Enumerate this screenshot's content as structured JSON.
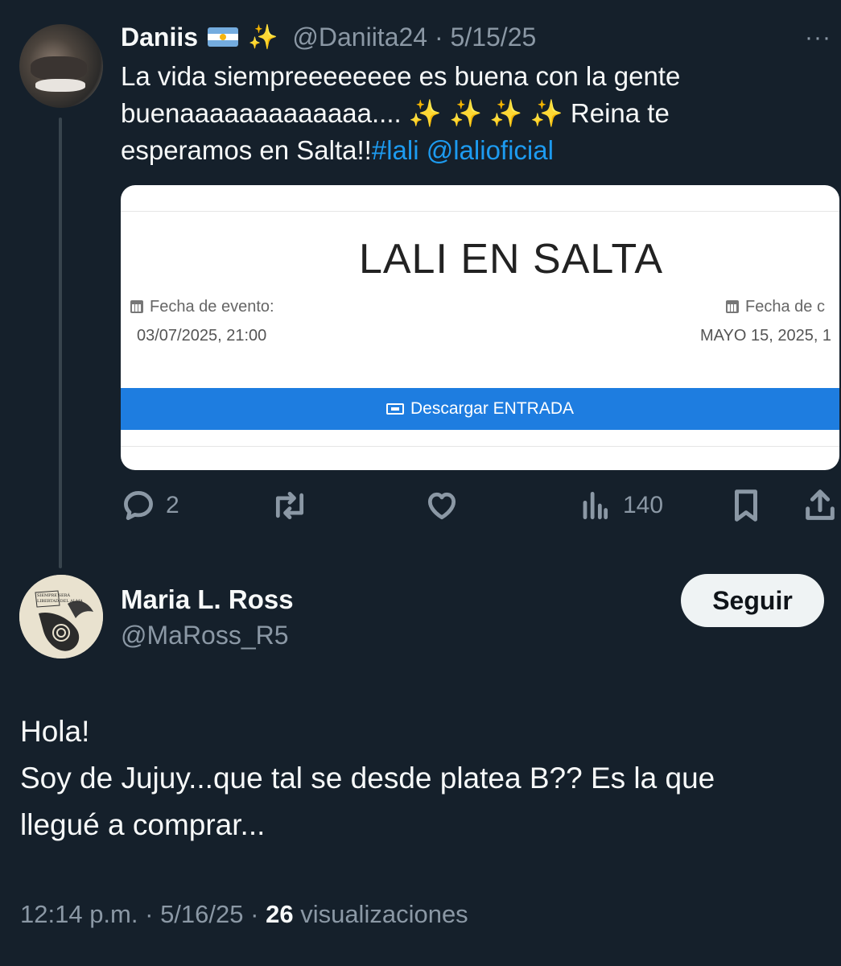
{
  "parent_tweet": {
    "name": "Daniis",
    "emoji_sparkle": "✨",
    "handle": "@Daniita24",
    "date": "5/15/25",
    "more": "···",
    "text_line1": "La vida siempreeeeeeee es buena con la gente",
    "text_line2_a": "buenaaaaaaaaaaaaa....",
    "text_sparkles": "✨ ✨ ✨ ✨",
    "text_line2_b": "Reina te",
    "text_line3": "esperamos en Salta!!",
    "hashtag": "#lali",
    "mention": "@lalioficial",
    "image_card": {
      "title": "LALI EN SALTA",
      "left_label": "Fecha de evento:",
      "left_value": "03/07/2025, 21:00",
      "right_label": "Fecha de c",
      "right_value": "MAYO 15, 2025, 1",
      "button_label": "Descargar ENTRADA"
    },
    "actions": {
      "replies": "2",
      "retweets": "",
      "likes": "",
      "views": "140"
    }
  },
  "reply_tweet": {
    "name": "Maria L. Ross",
    "handle": "@MaRoss_R5",
    "follow_label": "Seguir",
    "text_line1": "Hola!",
    "text_line2": "Soy de Jujuy...que tal se desde platea B?? Es la que",
    "text_line3": "llegué a comprar...",
    "time": "12:14 p.m.",
    "date": "5/16/25",
    "views_count": "26",
    "views_label": "visualizaciones",
    "separator": "·",
    "avatar_text": "SIEMPRE SERÁ LIBERTAD DEL ALMA"
  },
  "colors": {
    "background": "#15202b",
    "text": "#f7f9f9",
    "muted": "#8b98a5",
    "link": "#1d9bf0",
    "follow_button_bg": "#eff3f4"
  }
}
